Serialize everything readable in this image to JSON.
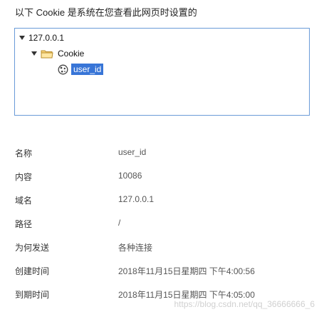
{
  "heading": "以下 Cookie 是系统在您查看此网页时设置的",
  "tree": {
    "host": "127.0.0.1",
    "folder": "Cookie",
    "cookie": "user_id"
  },
  "details": [
    {
      "key": "名称",
      "value": "user_id"
    },
    {
      "key": "内容",
      "value": "10086"
    },
    {
      "key": "域名",
      "value": "127.0.0.1"
    },
    {
      "key": "路径",
      "value": "/"
    },
    {
      "key": "为何发送",
      "value": "各种连接"
    },
    {
      "key": "创建时间",
      "value": "2018年11月15日星期四 下午4:00:56"
    },
    {
      "key": "到期时间",
      "value": "2018年11月15日星期四 下午4:05:00"
    }
  ],
  "watermark": "https://blog.csdn.net/qq_36666666_6",
  "colors": {
    "selection": "#3875d7",
    "border": "#6a9bd8",
    "folder": "#e8b84a"
  },
  "icons": {
    "expand": "triangle-down-icon",
    "folder": "folder-icon",
    "cookie": "cookie-icon"
  }
}
